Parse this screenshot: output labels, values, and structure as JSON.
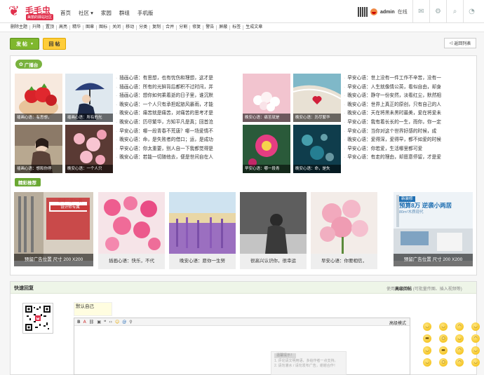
{
  "site": {
    "logo_name": "毛毛虫",
    "logo_sub": "美丽的驿站社区",
    "nav": [
      "首页",
      "社区 ▾",
      "家园",
      "群组",
      "手机版"
    ],
    "user": {
      "name": "admin",
      "status": "在线"
    }
  },
  "mod_actions": [
    "删除主题",
    "升降",
    "置顶",
    "高亮",
    "精华",
    "图章",
    "图标",
    "关闭",
    "移动",
    "分类",
    "复制",
    "合并",
    "分割",
    "修复",
    "警告",
    "屏蔽",
    "标签",
    "生成文章"
  ],
  "buttons": {
    "post": "发 帖",
    "post_caret": "▾",
    "reply": "回 帖",
    "back": "返回列表",
    "back_icon": "◁"
  },
  "broadcast": {
    "tag": "广播台",
    "left_thumbs": [
      {
        "caption": "插画心语：有思想，"
      },
      {
        "caption": "插画心语：所有的光"
      },
      {
        "caption": "插画心语：想和你停"
      },
      {
        "caption": "晚安心语：一个人只"
      }
    ],
    "left_list": [
      "插画心语：有思想，也有忧伤和理想，这才是",
      "插画心语：所有的光鲜背后都积不过时间，并",
      "插画心语：想你如何乘着逝的日子里，谁沉默",
      "晚安心语：一个人只有承担起旅风暴雨，才能",
      "晚安心语：痛苦就是痛苦，对痛苦的思考才是",
      "晚安心语：历尽繁华，方知平凡是真；回首沧",
      "早安心语：哪一段青春不荒唐？哪一场爱情不",
      "晚安心语：命，是失败者的借口；运，是成功",
      "早安心语：你太重要，别人自一下我都觉得是",
      "晚安心语：若能一切随他去，便是世间自在人"
    ],
    "right_thumbs": [
      {
        "caption": "晚安心语：痛苦就是"
      },
      {
        "caption": "晚安心语：历尽繁华"
      },
      {
        "caption": "早安心语：哪一段青"
      },
      {
        "caption": "晚安心语：命，是失"
      }
    ],
    "right_list": [
      "早安心语：世上没有一件工作不辛苦，没有一",
      "早安心语：人生就像情公英，看似自由，却身",
      "晚安心语：静守一份安然，淡看红尘，默然相",
      "晚安心语：世界上真正的原创，只有自己的人",
      "晚安心语：天在将黑未黑时最美，爱在将爱未",
      "早安心语：我有着长长的一生，而你，你一定",
      "早安心语：当你对这个世界好感的时候，成",
      "晚安心语：爱得深，爱得早，都不如爱的时候",
      "早安心语：你若爱，生活哪里都可爱",
      "早安心语：有走的理由，却愿意停留，才是爱"
    ]
  },
  "featured": {
    "tag": "精彩推荐",
    "cards": [
      {
        "caption": "预留广告位置 尺寸 200 X200",
        "ad_title": "原绿三原8w装",
        "ad_badge": "设计师专属"
      },
      {
        "caption": "插画心语：快乐，不代"
      },
      {
        "caption": "晚安心语：愿你一生努"
      },
      {
        "caption": "很高兴认识你，很幸运"
      },
      {
        "caption": "早安心语：你要相信，"
      },
      {
        "caption": "预留广告位置 尺寸 200 X200",
        "ad_title": "预算8万 逆袭小两居",
        "ad_badge": "新装修",
        "ad_small": "80m²木质现代"
      }
    ]
  },
  "quick_reply": {
    "title": "快速回复",
    "advanced_label": "使用",
    "advanced_link": "高级回帖",
    "advanced_hint": "(可批量传图、插入视频等)",
    "signature_line1": "默认自己",
    "signature_line2": "",
    "mode_label": "高级模式",
    "tooltip_title": "温馨提示！",
    "tooltip_lines": [
      "1. 评论请文明用语，多给作者一点支持。",
      "2. 请勿灌水 / 请勿发布广告，谢谢合作！"
    ]
  },
  "colors": {
    "brand": "#e0304c",
    "accent_green": "#79b23e",
    "post_yellow": "#ffcd3a"
  }
}
